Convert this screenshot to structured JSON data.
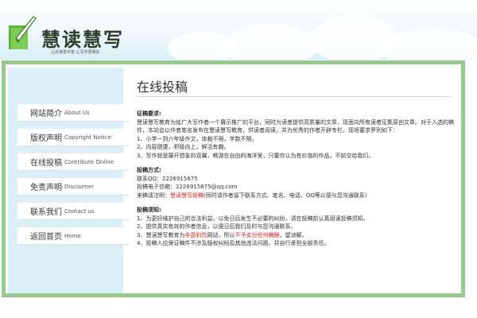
{
  "header": {
    "logo_text": "慧读慧写",
    "logo_sub": "让阅读更丰富 让写作更精彩"
  },
  "colors": {
    "frame": "#97c88e",
    "sidebar": "#dceff6",
    "accent_red": "#e02020",
    "logo_green": "#5fb23c"
  },
  "nav": [
    {
      "cn": "网站简介",
      "en": "About Us"
    },
    {
      "cn": "版权声明",
      "en": "Copyright Notice"
    },
    {
      "cn": "在线投稿",
      "en": "Contribute Online"
    },
    {
      "cn": "免责声明",
      "en": "Disclaimer"
    },
    {
      "cn": "联系我们",
      "en": "Contact us"
    },
    {
      "cn": "返回首页",
      "en": "Home"
    }
  ],
  "page": {
    "title": "在线投稿",
    "requirements": {
      "heading": "征稿要求:",
      "intro": "慧读慧写教育为给广大写作者一个展示推广的平台，同时为读者提供高质量的文章，现面向所有读者征集原创文章。对于入选的稿件，本站会以作者笔名发布在慧读慧写教育，供读者阅读，并为优秀的作者开辟专栏。现将要求罗列如下：",
      "items": [
        "1、小学一到六年级作文，体裁不限，字数不限。",
        "2、内容健康，积极向上，鲜活有趣。",
        "3、写作就是展开想象的双翼，畅游在自由的海洋里，只要你认为有价值的作品，不妨交给我们。"
      ]
    },
    "methods": {
      "heading": "投稿方式:",
      "qq": "联系QQ：2226915875",
      "email": "投稿电子信箱：2226915875@qq.com",
      "subject_prefix": "来稿请注明：",
      "subject_red": "慧读慧写投稿",
      "subject_rest": "(同时请作者留下联系方式、笔名、电话、QQ等以便与您沟通联系)"
    },
    "notes": {
      "heading": "投稿须知:",
      "n1": "1、为更好维护自己的合法利益，以免日后发生不必要的纠纷，请在投稿前认真阅读投稿须知。",
      "n2": "2、提供真实有效的作者信息，以便日后我们及时与您沟通联系。",
      "n3_a": "3、慧读慧写教育为",
      "n3_red1": "非盈利性",
      "n3_b": "网站，所以",
      "n3_red2": "不予支付任何稿酬",
      "n3_c": "，望谅解。",
      "n4": "4、投稿人应保证稿件不涉及版权纠纷及其他违法问题，并自行承担全部责任。"
    }
  }
}
